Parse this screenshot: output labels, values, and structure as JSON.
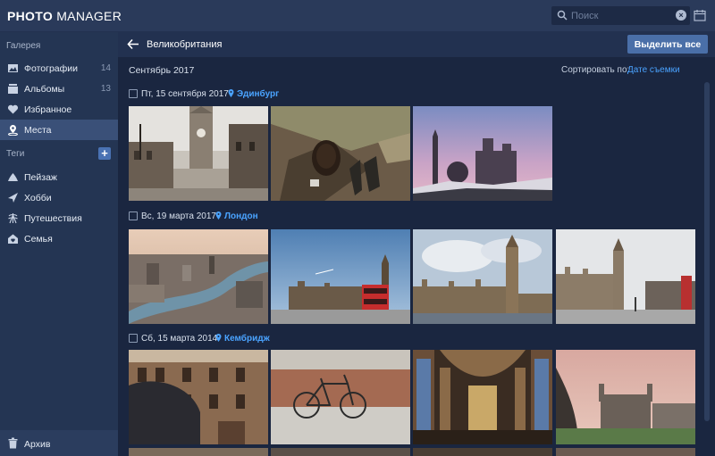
{
  "app": {
    "logo_bold": "PHOTO",
    "logo_light": " MANAGER"
  },
  "search": {
    "placeholder": "Поиск",
    "value": ""
  },
  "sidebar": {
    "gallery_heading": "Галерея",
    "items": [
      {
        "label": "Фотографии",
        "count": "14",
        "icon": "photos-icon"
      },
      {
        "label": "Альбомы",
        "count": "13",
        "icon": "albums-icon"
      },
      {
        "label": "Избранное",
        "count": "",
        "icon": "heart-icon"
      },
      {
        "label": "Места",
        "count": "",
        "icon": "map-pin-icon",
        "active": true
      }
    ],
    "tags_heading": "Теги",
    "tags": [
      {
        "label": "Пейзаж",
        "icon": "landscape-icon"
      },
      {
        "label": "Хобби",
        "icon": "hobby-icon"
      },
      {
        "label": "Путешествия",
        "icon": "travel-icon"
      },
      {
        "label": "Семья",
        "icon": "family-icon"
      }
    ],
    "archive_label": "Архив"
  },
  "content": {
    "title": "Великобритания",
    "select_all_label": "Выделить все",
    "month": "Сентябрь 2017",
    "sort_label": "Сортировать по:",
    "sort_value": "Дате съемки",
    "groups": [
      {
        "date": "Пт, 15 сентября 2017",
        "location": "Эдинбург",
        "photos": [
          "edinburgh-street-clocktower",
          "hiker-backpack-rocks",
          "edinburgh-castle-dusk"
        ]
      },
      {
        "date": "Вс, 19 марта 2017",
        "location": "Лондон",
        "photos": [
          "london-thames-aerial",
          "big-ben-red-bus",
          "westminster-palace-clouds",
          "big-ben-winter-street"
        ]
      },
      {
        "date": "Сб, 15 марта 2014",
        "location": "Кембридж",
        "photos": [
          "cambridge-brick-building",
          "bicycle-brick-wall",
          "kings-college-chapel-interior",
          "kings-college-exterior"
        ]
      }
    ]
  },
  "colors": {
    "accent": "#4aa3ff",
    "sidebar_bg": "#243553",
    "content_bg": "#1a2640",
    "active_item": "#3a5078"
  }
}
